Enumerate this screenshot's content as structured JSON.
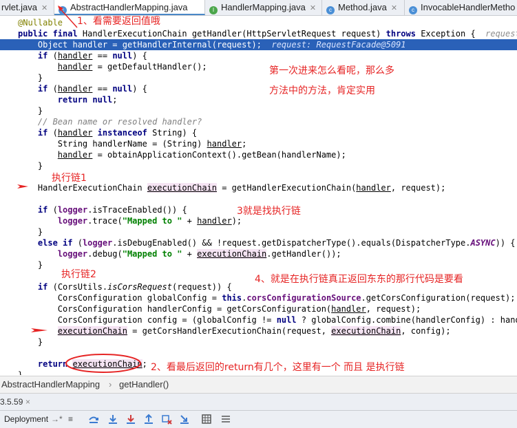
{
  "tabs": [
    {
      "label": "rvlet.java",
      "icon": "java-class-icon",
      "color": "#c97b3c",
      "closable": true
    },
    {
      "label": "AbstractHandlerMapping.java",
      "icon": "java-class-icon",
      "color": "#4a8fd6",
      "closable": false,
      "active": true
    },
    {
      "label": "HandlerMapping.java",
      "icon": "java-interface-icon",
      "color": "#4ca64c",
      "closable": true
    },
    {
      "label": "Method.java",
      "icon": "java-class-icon",
      "color": "#4a8fd6",
      "closable": true
    },
    {
      "label": "InvocableHandlerMetho",
      "icon": "java-class-icon",
      "color": "#4a8fd6",
      "closable": false
    }
  ],
  "code": {
    "line_annotation": "@Nullable",
    "line_signature": [
      {
        "t": "public final ",
        "c": "kw"
      },
      {
        "t": "HandlerExecutionChain getHandler(HttpServletRequest request) ",
        "c": ""
      },
      {
        "t": "throws ",
        "c": "kw"
      },
      {
        "t": "Exception {  ",
        "c": ""
      },
      {
        "t": "request: R",
        "c": "hint"
      }
    ],
    "lines": [
      [
        {
          "t": "    Object handler = getHandlerInternal(request);  ",
          "c": ""
        },
        {
          "t": "request: RequestFacade@5091",
          "c": "hint"
        }
      ],
      [
        {
          "t": "    ",
          "c": ""
        },
        {
          "t": "if ",
          "c": "kw"
        },
        {
          "t": "(",
          "c": ""
        },
        {
          "t": "handler",
          "c": "ul"
        },
        {
          "t": " == ",
          "c": ""
        },
        {
          "t": "null",
          "c": "kw"
        },
        {
          "t": ") {",
          "c": ""
        }
      ],
      [
        {
          "t": "        ",
          "c": ""
        },
        {
          "t": "handler",
          "c": "ul"
        },
        {
          "t": " = getDefaultHandler();",
          "c": ""
        }
      ],
      [
        {
          "t": "    }",
          "c": ""
        }
      ],
      [
        {
          "t": "    ",
          "c": ""
        },
        {
          "t": "if ",
          "c": "kw"
        },
        {
          "t": "(",
          "c": ""
        },
        {
          "t": "handler",
          "c": "ul"
        },
        {
          "t": " == ",
          "c": ""
        },
        {
          "t": "null",
          "c": "kw"
        },
        {
          "t": ") {",
          "c": ""
        }
      ],
      [
        {
          "t": "        ",
          "c": ""
        },
        {
          "t": "return null",
          "c": "kw"
        },
        {
          "t": ";",
          "c": ""
        }
      ],
      [
        {
          "t": "    }",
          "c": ""
        }
      ],
      [
        {
          "t": "    // Bean name or resolved handler?",
          "c": "cmt"
        }
      ],
      [
        {
          "t": "    ",
          "c": ""
        },
        {
          "t": "if ",
          "c": "kw"
        },
        {
          "t": "(",
          "c": ""
        },
        {
          "t": "handler",
          "c": "ul"
        },
        {
          "t": " ",
          "c": ""
        },
        {
          "t": "instanceof ",
          "c": "kw"
        },
        {
          "t": "String) {",
          "c": ""
        }
      ],
      [
        {
          "t": "        String handlerName = (String) ",
          "c": ""
        },
        {
          "t": "handler",
          "c": "ul"
        },
        {
          "t": ";",
          "c": ""
        }
      ],
      [
        {
          "t": "        ",
          "c": ""
        },
        {
          "t": "handler",
          "c": "ul"
        },
        {
          "t": " = obtainApplicationContext().getBean(handlerName);",
          "c": ""
        }
      ],
      [
        {
          "t": "    }",
          "c": ""
        }
      ],
      [
        {
          "t": "",
          "c": ""
        }
      ],
      [
        {
          "t": "    HandlerExecutionChain ",
          "c": ""
        },
        {
          "t": "executionChain",
          "c": "var"
        },
        {
          "t": " = getHandlerExecutionChain(",
          "c": ""
        },
        {
          "t": "handler",
          "c": "ul"
        },
        {
          "t": ", request);",
          "c": ""
        }
      ],
      [
        {
          "t": "",
          "c": ""
        }
      ],
      [
        {
          "t": "    ",
          "c": ""
        },
        {
          "t": "if ",
          "c": "kw"
        },
        {
          "t": "(",
          "c": ""
        },
        {
          "t": "logger",
          "c": "fld"
        },
        {
          "t": ".isTraceEnabled()) {",
          "c": ""
        }
      ],
      [
        {
          "t": "        ",
          "c": ""
        },
        {
          "t": "logger",
          "c": "fld"
        },
        {
          "t": ".trace(",
          "c": ""
        },
        {
          "t": "\"Mapped to \"",
          "c": "str"
        },
        {
          "t": " + ",
          "c": ""
        },
        {
          "t": "handler",
          "c": "ul"
        },
        {
          "t": ");",
          "c": ""
        }
      ],
      [
        {
          "t": "    }",
          "c": ""
        }
      ],
      [
        {
          "t": "    ",
          "c": ""
        },
        {
          "t": "else if ",
          "c": "kw"
        },
        {
          "t": "(",
          "c": ""
        },
        {
          "t": "logger",
          "c": "fld"
        },
        {
          "t": ".isDebugEnabled() && !request.getDispatcherType().equals(DispatcherType.",
          "c": ""
        },
        {
          "t": "ASYNC",
          "c": "fld ital"
        },
        {
          "t": ")) {",
          "c": ""
        }
      ],
      [
        {
          "t": "        ",
          "c": ""
        },
        {
          "t": "logger",
          "c": "fld"
        },
        {
          "t": ".debug(",
          "c": ""
        },
        {
          "t": "\"Mapped to \"",
          "c": "str"
        },
        {
          "t": " + ",
          "c": ""
        },
        {
          "t": "executionChain",
          "c": "var"
        },
        {
          "t": ".getHandler());",
          "c": ""
        }
      ],
      [
        {
          "t": "    }",
          "c": ""
        }
      ],
      [
        {
          "t": "",
          "c": ""
        }
      ],
      [
        {
          "t": "    ",
          "c": ""
        },
        {
          "t": "if ",
          "c": "kw"
        },
        {
          "t": "(CorsUtils.",
          "c": ""
        },
        {
          "t": "isCorsRequest",
          "c": "ital"
        },
        {
          "t": "(request)) {",
          "c": ""
        }
      ],
      [
        {
          "t": "        CorsConfiguration globalConfig = ",
          "c": ""
        },
        {
          "t": "this",
          "c": "kw"
        },
        {
          "t": ".",
          "c": ""
        },
        {
          "t": "corsConfigurationSource",
          "c": "fld"
        },
        {
          "t": ".getCorsConfiguration(request);",
          "c": ""
        }
      ],
      [
        {
          "t": "        CorsConfiguration handlerConfig = getCorsConfiguration(",
          "c": ""
        },
        {
          "t": "handler",
          "c": "ul"
        },
        {
          "t": ", request);",
          "c": ""
        }
      ],
      [
        {
          "t": "        CorsConfiguration config = (globalConfig != ",
          "c": ""
        },
        {
          "t": "null",
          "c": "kw"
        },
        {
          "t": " ? globalConfig.combine(handlerConfig) : handlerConfig);",
          "c": ""
        }
      ],
      [
        {
          "t": "        ",
          "c": ""
        },
        {
          "t": "executionChain",
          "c": "var"
        },
        {
          "t": " = getCorsHandlerExecutionChain(request, ",
          "c": ""
        },
        {
          "t": "executionChain",
          "c": "var"
        },
        {
          "t": ", config);",
          "c": ""
        }
      ],
      [
        {
          "t": "    }",
          "c": ""
        }
      ],
      [
        {
          "t": "",
          "c": ""
        }
      ],
      [
        {
          "t": "    ",
          "c": ""
        },
        {
          "t": "return ",
          "c": "kw"
        },
        {
          "t": "executionChain",
          "c": "var"
        },
        {
          "t": ";",
          "c": ""
        }
      ],
      [
        {
          "t": "}",
          "c": ""
        }
      ]
    ]
  },
  "notes": {
    "n1": "1、看需要返回值哦",
    "n2": "第一次进来怎么看呢，那么多",
    "n3": "方法中的方法，肯定实用",
    "n4": "执行链1",
    "n5": "3就是找执行链",
    "n6": "执行链2",
    "n7": "4、就是在执行链真正返回东东的那行代码是要看",
    "n8": "2、看最后返回的return有几个，这里有一个  而且 是执行链"
  },
  "breadcrumb": {
    "class_name": "AbstractHandlerMapping",
    "separator": "›",
    "method_name": "getHandler()"
  },
  "version_bar": {
    "version": "3.5.59",
    "close": "×"
  },
  "toolbar": {
    "deployment_label": "Deployment",
    "deployment_arrow": "→*",
    "menu_glyph": "≡"
  },
  "colors": {
    "annotation_red": "#e62424",
    "highlight_blue": "#2a61b8"
  }
}
